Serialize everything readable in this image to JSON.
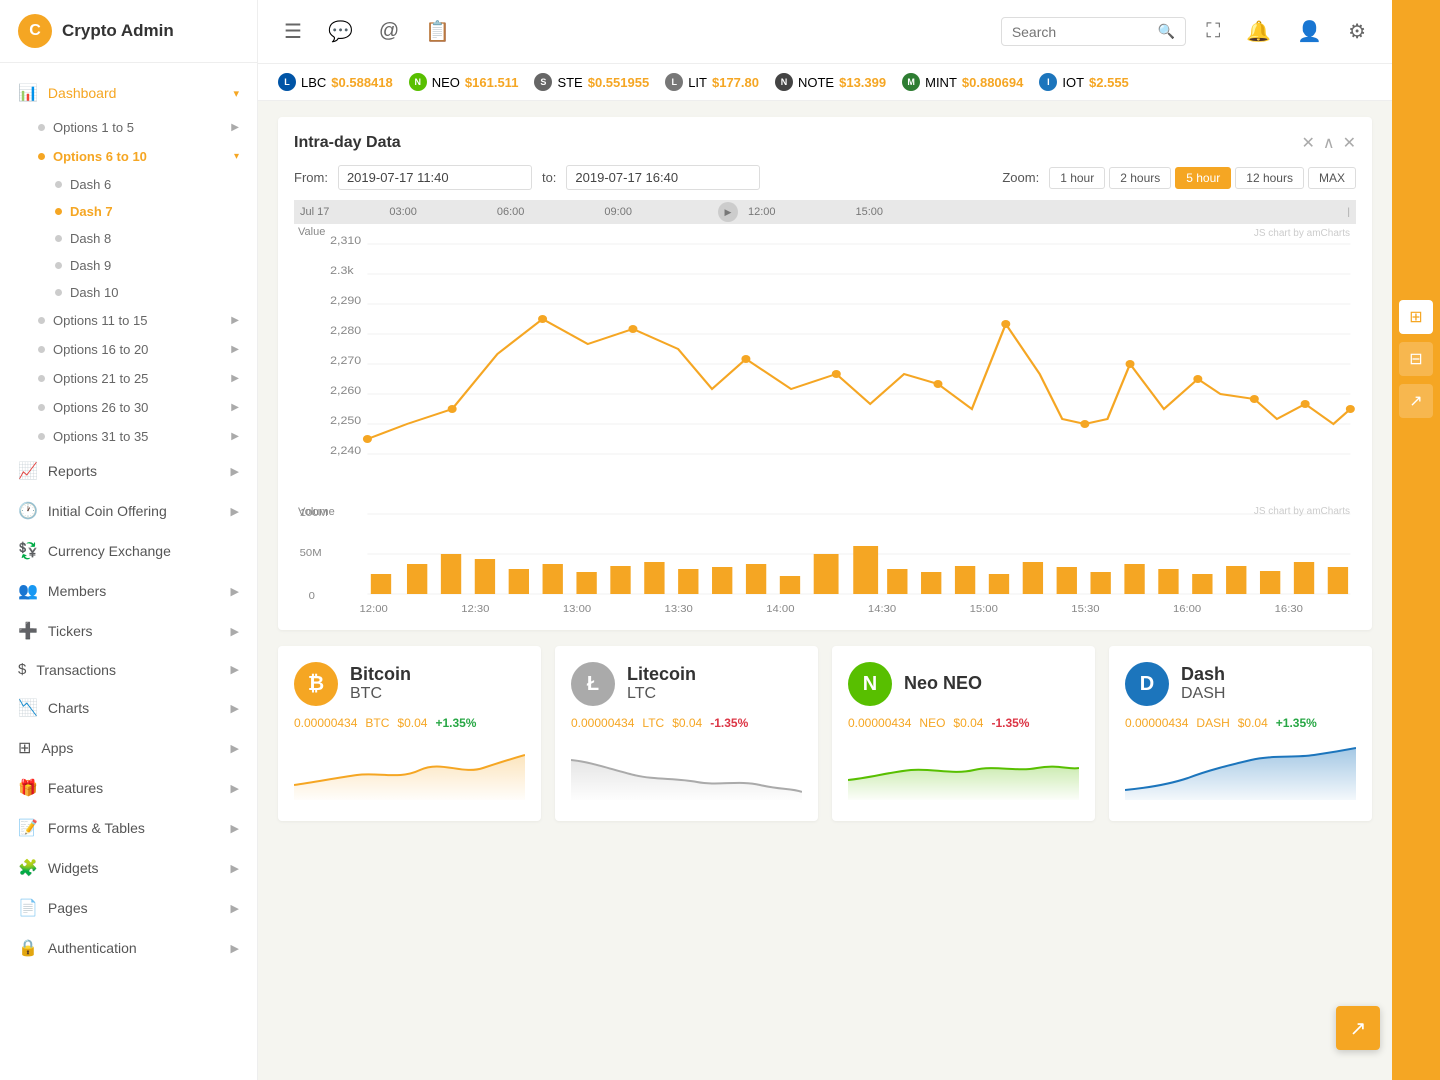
{
  "app": {
    "name": "Crypto Admin",
    "logo_char": "C"
  },
  "topbar": {
    "icons": [
      "☰",
      "💬",
      "@",
      "📋"
    ],
    "search_placeholder": "Search",
    "right_icons": [
      "⛶",
      "🔔",
      "👤",
      "⚙"
    ]
  },
  "ticker": [
    {
      "symbol": "LBC",
      "price": "$0.588418",
      "icon_bg": "#0054a6",
      "icon_char": "L"
    },
    {
      "symbol": "NEO",
      "price": "$161.511",
      "icon_bg": "#58bf00",
      "icon_char": "N"
    },
    {
      "symbol": "STE",
      "price": "$0.551955",
      "icon_bg": "#555",
      "icon_char": "S"
    },
    {
      "symbol": "LIT",
      "price": "$177.80",
      "icon_bg": "#666",
      "icon_char": "L"
    },
    {
      "symbol": "NOTE",
      "price": "$13.399",
      "icon_bg": "#444",
      "icon_char": "N"
    },
    {
      "symbol": "MINT",
      "price": "$0.880694",
      "icon_bg": "#2e7d32",
      "icon_char": "M"
    },
    {
      "symbol": "IOT",
      "price": "$2.555",
      "icon_bg": "#1c75bc",
      "icon_char": "I"
    }
  ],
  "sidebar": {
    "items": [
      {
        "id": "dashboard",
        "label": "Dashboard",
        "icon": "📊",
        "active": true,
        "has_arrow": true,
        "arrow_dir": "down"
      },
      {
        "id": "reports",
        "label": "Reports",
        "icon": "📈",
        "active": false,
        "has_arrow": true
      },
      {
        "id": "ico",
        "label": "Initial Coin Offering",
        "icon": "🕐",
        "active": false,
        "has_arrow": true
      },
      {
        "id": "currency-exchange",
        "label": "Currency Exchange",
        "icon": "💱",
        "active": false,
        "has_arrow": false
      },
      {
        "id": "members",
        "label": "Members",
        "icon": "👥",
        "active": false,
        "has_arrow": true
      },
      {
        "id": "tickers",
        "label": "Tickers",
        "icon": "➕",
        "active": false,
        "has_arrow": true
      },
      {
        "id": "transactions",
        "label": "Transactions",
        "icon": "$",
        "active": false,
        "has_arrow": true
      },
      {
        "id": "charts",
        "label": "Charts",
        "icon": "📉",
        "active": false,
        "has_arrow": true
      },
      {
        "id": "apps",
        "label": "Apps",
        "icon": "⊞",
        "active": false,
        "has_arrow": true
      },
      {
        "id": "features",
        "label": "Features",
        "icon": "🎁",
        "active": false,
        "has_arrow": true
      },
      {
        "id": "forms-tables",
        "label": "Forms & Tables",
        "icon": "📝",
        "active": false,
        "has_arrow": true
      },
      {
        "id": "widgets",
        "label": "Widgets",
        "icon": "🧩",
        "active": false,
        "has_arrow": true
      },
      {
        "id": "pages",
        "label": "Pages",
        "icon": "📄",
        "active": false,
        "has_arrow": true
      },
      {
        "id": "authentication",
        "label": "Authentication",
        "icon": "🔒",
        "active": false,
        "has_arrow": true
      }
    ],
    "sub_items_1_5": {
      "label": "Options 1 to 5",
      "arrow": true
    },
    "sub_items_6_10": {
      "label": "Options 6 to 10",
      "arrow": true,
      "open": true
    },
    "dash_items": [
      "Dash 6",
      "Dash 7",
      "Dash 8",
      "Dash 9",
      "Dash 10"
    ],
    "active_dash": "Dash 7",
    "sub_items_11_15": {
      "label": "Options 11 to 15"
    },
    "sub_items_16_20": {
      "label": "Options 16 to 20"
    },
    "sub_items_21_25": {
      "label": "Options 21 to 25"
    },
    "sub_items_26_30": {
      "label": "Options 26 to 30"
    },
    "sub_items_31_35": {
      "label": "Options 31 to 35"
    }
  },
  "intraday": {
    "title": "Intra-day Data",
    "from_label": "From:",
    "to_label": "to:",
    "from_value": "2019-07-17 11:40",
    "to_value": "2019-07-17 16:40",
    "zoom_label": "Zoom:",
    "zoom_options": [
      "1 hour",
      "2 hours",
      "5 hour",
      "12 hours",
      "MAX"
    ],
    "active_zoom": "5 hour",
    "timeline_labels": [
      "Jul 17",
      "03:00",
      "06:00",
      "09:00",
      "12:00",
      "15:00"
    ],
    "y_label": "Value",
    "y_values": [
      "2,310",
      "2.3k",
      "2,290",
      "2,280",
      "2,270",
      "2,260",
      "2,250",
      "2,240"
    ],
    "chart_credit": "JS chart by amCharts",
    "volume_label": "Volume",
    "volume_y_values": [
      "100M",
      "50M",
      "0"
    ],
    "volume_x_labels": [
      "12:00",
      "12:30",
      "13:00",
      "13:30",
      "14:00",
      "14:30",
      "15:00",
      "15:30",
      "16:00",
      "16:30"
    ]
  },
  "coins": [
    {
      "id": "bitcoin",
      "name": "Bitcoin",
      "ticker": "BTC",
      "logo_class": "btc",
      "logo_char": "₿",
      "amount": "0.00000434",
      "currency": "BTC",
      "usd": "$0.04",
      "change": "+1.35%",
      "change_positive": true,
      "sparkline_color": "#f5a623"
    },
    {
      "id": "litecoin",
      "name": "Litecoin",
      "ticker": "LTC",
      "logo_class": "ltc",
      "logo_char": "Ł",
      "amount": "0.00000434",
      "currency": "LTC",
      "usd": "$0.04",
      "change": "-1.35%",
      "change_positive": false,
      "sparkline_color": "#aaa"
    },
    {
      "id": "neo",
      "name": "Neo NEO",
      "ticker": "NEO",
      "logo_class": "neo",
      "logo_char": "N",
      "amount": "0.00000434",
      "currency": "NEO",
      "usd": "$0.04",
      "change": "-1.35%",
      "change_positive": false,
      "sparkline_color": "#58bf00"
    },
    {
      "id": "dash",
      "name": "Dash",
      "ticker": "DASH",
      "logo_class": "dash",
      "logo_char": "D",
      "amount": "0.00000434",
      "currency": "DASH",
      "usd": "$0.04",
      "change": "+1.35%",
      "change_positive": true,
      "sparkline_color": "#1c75bc"
    }
  ]
}
